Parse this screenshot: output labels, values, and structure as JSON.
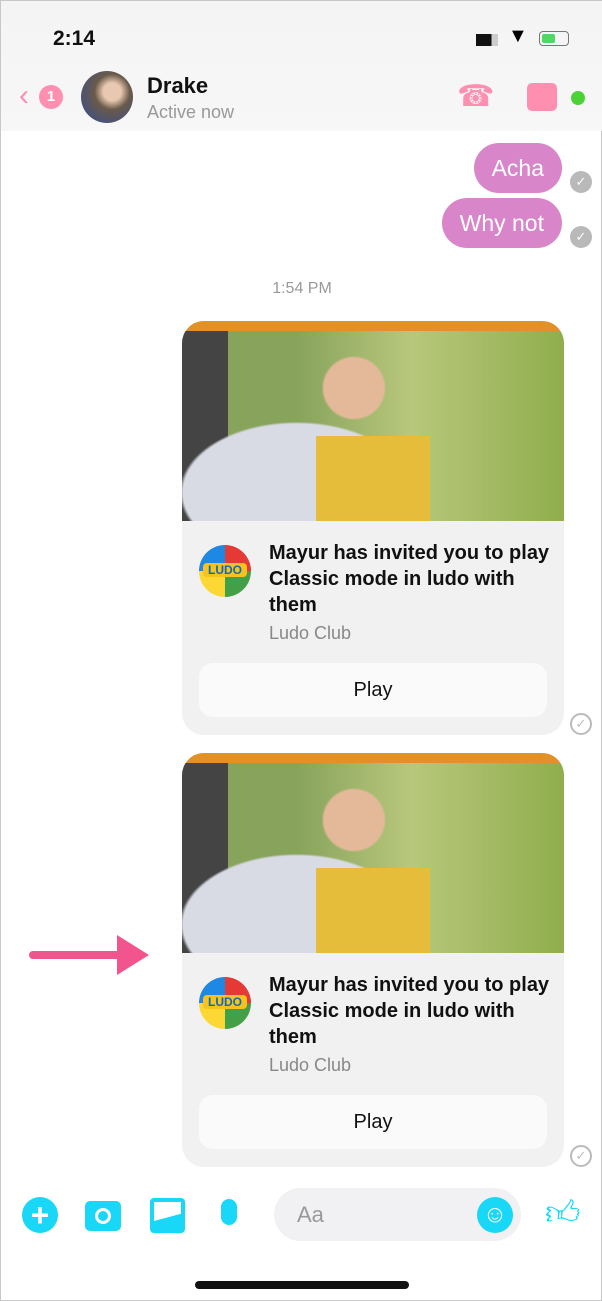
{
  "status": {
    "time": "2:14"
  },
  "header": {
    "back_badge": "1",
    "name": "Drake",
    "status": "Active now"
  },
  "messages": [
    {
      "text": "Acha"
    },
    {
      "text": "Why not"
    }
  ],
  "timestamp": "1:54 PM",
  "cards": [
    {
      "title": "Mayur has invited you to play Classic mode in ludo with them",
      "source": "Ludo Club",
      "button": "Play",
      "logo_text": "LUDO"
    },
    {
      "title": "Mayur has invited you to play Classic mode in ludo with them",
      "source": "Ludo Club",
      "button": "Play",
      "logo_text": "LUDO"
    }
  ],
  "composer": {
    "placeholder": "Aa"
  },
  "colors": {
    "accent": "#18d7f7",
    "bubble": "#d886c9",
    "header_icons": "#ff8fb1",
    "annotation_arrow": "#f2558e"
  }
}
